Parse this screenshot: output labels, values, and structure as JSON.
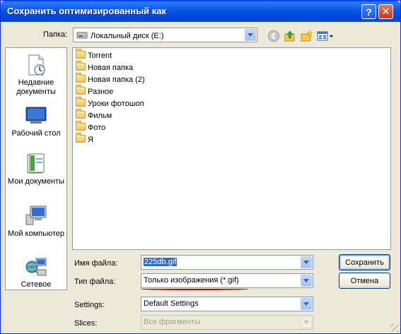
{
  "window": {
    "title": "Сохранить оптимизированный как",
    "help_label": "?",
    "close_label": "✕"
  },
  "lookin": {
    "label": "Папка:",
    "value": "Локальный диск (E:)"
  },
  "toolbar": {
    "icons": [
      "back-icon",
      "up-folder-icon",
      "new-folder-icon",
      "views-menu-icon"
    ]
  },
  "places": [
    {
      "label": "Недавние документы",
      "icon": "recent-documents-icon"
    },
    {
      "label": "Рабочий стол",
      "icon": "desktop-icon"
    },
    {
      "label": "Мои документы",
      "icon": "my-documents-icon"
    },
    {
      "label": "Мой компьютер",
      "icon": "my-computer-icon"
    },
    {
      "label": "Сетевое",
      "icon": "network-icon"
    }
  ],
  "files": [
    {
      "name": "Torrent"
    },
    {
      "name": "Новая папка"
    },
    {
      "name": "Новая папка (2)"
    },
    {
      "name": "Разное"
    },
    {
      "name": "Уроки фотошоп"
    },
    {
      "name": "Фильм"
    },
    {
      "name": "Фото"
    },
    {
      "name": "Я"
    }
  ],
  "form": {
    "filename_label": "Имя файла:",
    "filename_value": "225db.gif",
    "filetype_label": "Тип файла:",
    "filetype_value": "Только изображения (*.gif)",
    "settings_label": "Settings:",
    "settings_value": "Default Settings",
    "slices_label": "Slices:",
    "slices_value": "Все фрагменты"
  },
  "buttons": {
    "save": "Сохранить",
    "cancel": "Отмена"
  },
  "colors": {
    "title_bar": "#0a55e6",
    "selection": "#316ac5",
    "annotation_underline": "#d00000"
  }
}
